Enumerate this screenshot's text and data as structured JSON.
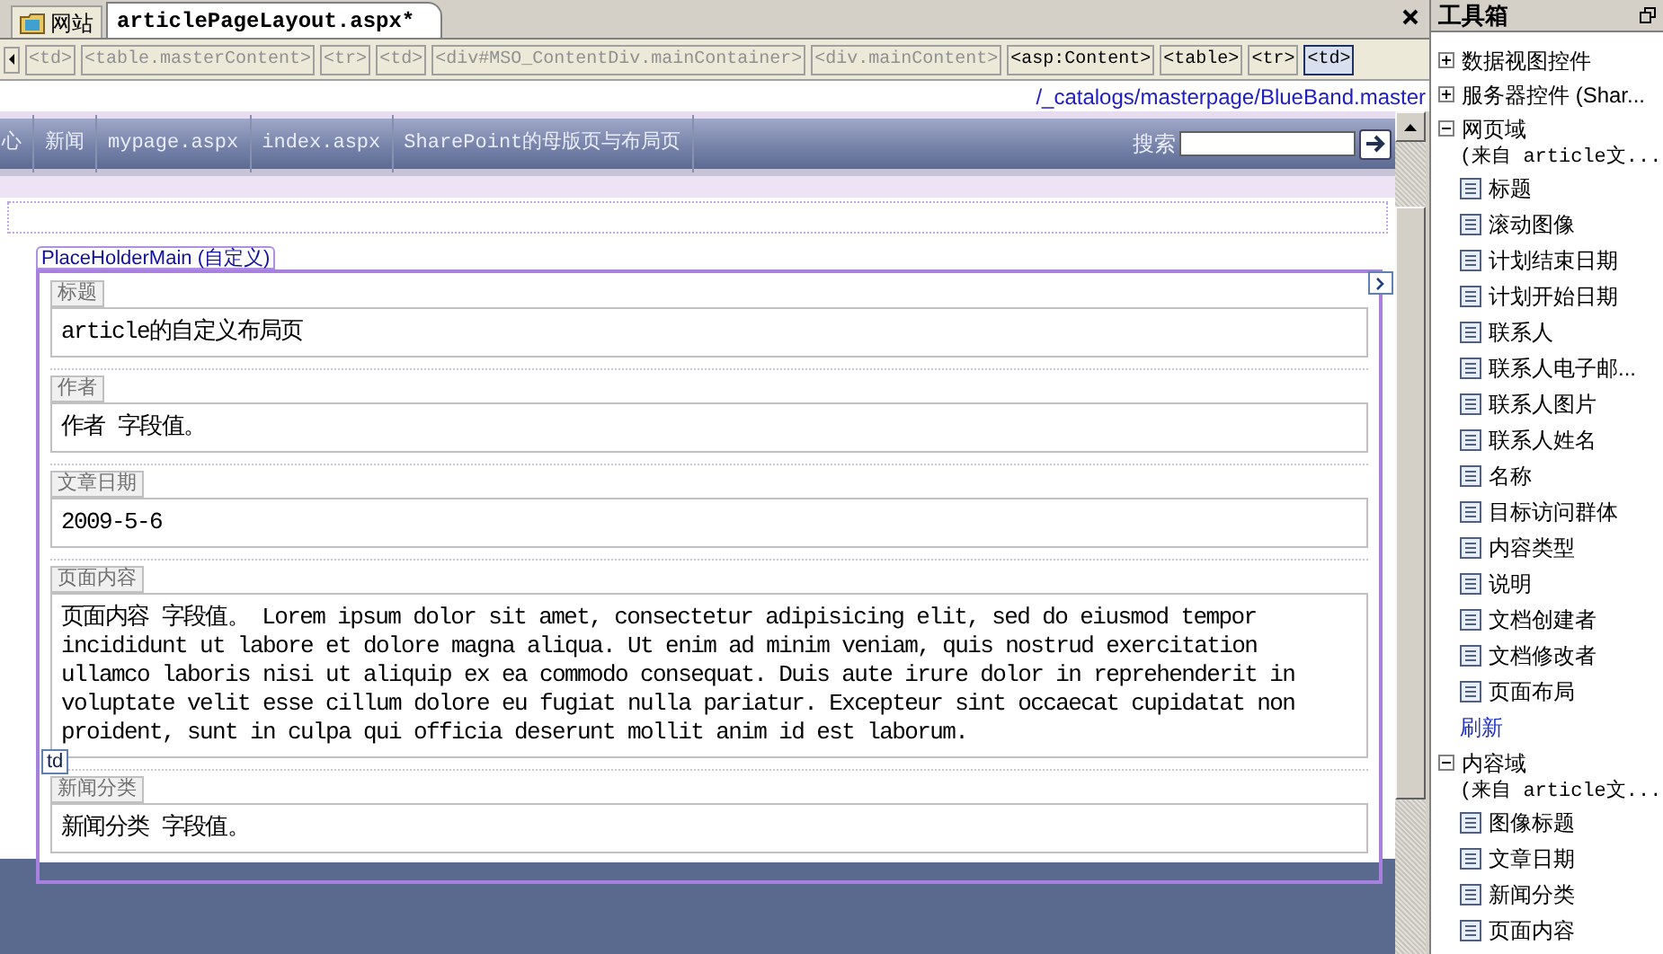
{
  "editor": {
    "tabs": [
      {
        "label": "网站",
        "selected": false,
        "kind": "folder"
      },
      {
        "label": "articlePageLayout.aspx*",
        "selected": true,
        "kind": "file"
      }
    ],
    "breadcrumb": [
      {
        "label": "<td>",
        "disabled": true,
        "selected": false
      },
      {
        "label": "<table.masterContent>",
        "disabled": true,
        "selected": false
      },
      {
        "label": "<tr>",
        "disabled": true,
        "selected": false
      },
      {
        "label": "<td>",
        "disabled": true,
        "selected": false
      },
      {
        "label": "<div#MSO_ContentDiv.mainContainer>",
        "disabled": true,
        "selected": false
      },
      {
        "label": "<div.mainContent>",
        "disabled": true,
        "selected": false
      },
      {
        "label": "<asp:Content>",
        "disabled": false,
        "selected": false
      },
      {
        "label": "<table>",
        "disabled": false,
        "selected": false
      },
      {
        "label": "<tr>",
        "disabled": false,
        "selected": false
      },
      {
        "label": "<td>",
        "disabled": false,
        "selected": true
      }
    ],
    "master_path": "/_catalogs/masterpage/BlueBand.master",
    "nav": {
      "items": [
        "心",
        "新闻",
        "mypage.aspx",
        "index.aspx",
        "SharePoint的母版页与布局页"
      ],
      "search_label": "搜索"
    },
    "placeholder": {
      "label": "PlaceHolderMain (自定义)",
      "tag": "td",
      "fields": [
        {
          "label": "标题",
          "value": "article的自定义布局页"
        },
        {
          "label": "作者",
          "value": "作者 字段值。"
        },
        {
          "label": "文章日期",
          "value": "2009-5-6"
        },
        {
          "label": "页面内容",
          "value": "页面内容 字段值。 Lorem ipsum dolor sit amet, consectetur adipisicing elit, sed do eiusmod tempor incididunt ut labore et dolore magna aliqua. Ut enim ad minim veniam, quis nostrud exercitation ullamco laboris nisi ut aliquip ex ea commodo consequat. Duis aute irure dolor in reprehenderit in voluptate velit esse cillum dolore eu fugiat nulla pariatur. Excepteur sint occaecat cupidatat non proident, sunt in culpa qui officia deserunt mollit anim id est laborum."
        },
        {
          "label": "新闻分类",
          "value": "新闻分类 字段值。"
        }
      ]
    }
  },
  "toolbox": {
    "title": "工具箱",
    "groups": [
      {
        "label": "数据视图控件",
        "expanded": false
      },
      {
        "label": "服务器控件 (Shar...",
        "expanded": false
      },
      {
        "label": "网页域",
        "expanded": true,
        "source": "(来自 article文...",
        "items": [
          "标题",
          "滚动图像",
          "计划结束日期",
          "计划开始日期",
          "联系人",
          "联系人电子邮...",
          "联系人图片",
          "联系人姓名",
          "名称",
          "目标访问群体",
          "内容类型",
          "说明",
          "文档创建者",
          "文档修改者",
          "页面布局"
        ],
        "action": "刷新"
      },
      {
        "label": "内容域",
        "expanded": true,
        "source": "(来自 article文...",
        "items": [
          "图像标题",
          "文章日期",
          "新闻分类",
          "页面内容"
        ]
      }
    ]
  }
}
